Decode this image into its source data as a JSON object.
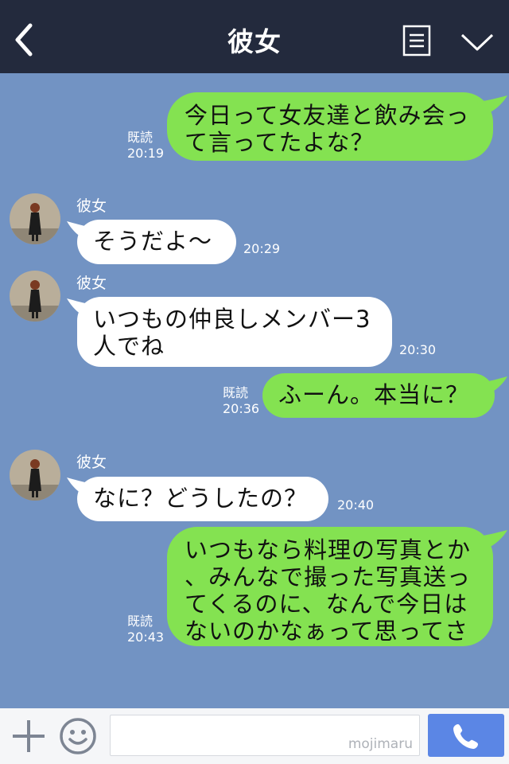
{
  "header": {
    "title": "彼女"
  },
  "messages": [
    {
      "dir": "out",
      "lines": [
        "今日って女友達と飲み会っ",
        "て言ってたよな？"
      ],
      "read": "既読",
      "time": "20:19"
    },
    {
      "dir": "in",
      "sender": "彼女",
      "lines": [
        "そうだよ〜"
      ],
      "time": "20:29"
    },
    {
      "dir": "in",
      "sender": "彼女",
      "lines": [
        "いつもの仲良しメンバー3",
        "人でね"
      ],
      "time": "20:30"
    },
    {
      "dir": "out",
      "lines": [
        "ふーん。本当に？"
      ],
      "read": "既読",
      "time": "20:36"
    },
    {
      "dir": "in",
      "sender": "彼女",
      "lines": [
        "なに？どうしたの？"
      ],
      "time": "20:40"
    },
    {
      "dir": "out",
      "lines": [
        "いつもなら料理の写真とか",
        "、みんなで撮った写真送っ",
        "てくるのに、なんで今日は",
        "ないのかなぁって思ってさ"
      ],
      "read": "既読",
      "time": "20:43"
    }
  ],
  "footer": {
    "watermark": "mojimaru"
  },
  "colors": {
    "header": "#232a3d",
    "background": "#7293c3",
    "outgoing": "#84e251",
    "incoming": "#ffffff",
    "call": "#5b86e5"
  },
  "icons": [
    "back-icon",
    "menu-icon",
    "chevron-down-icon",
    "plus-icon",
    "smile-icon",
    "phone-icon"
  ]
}
